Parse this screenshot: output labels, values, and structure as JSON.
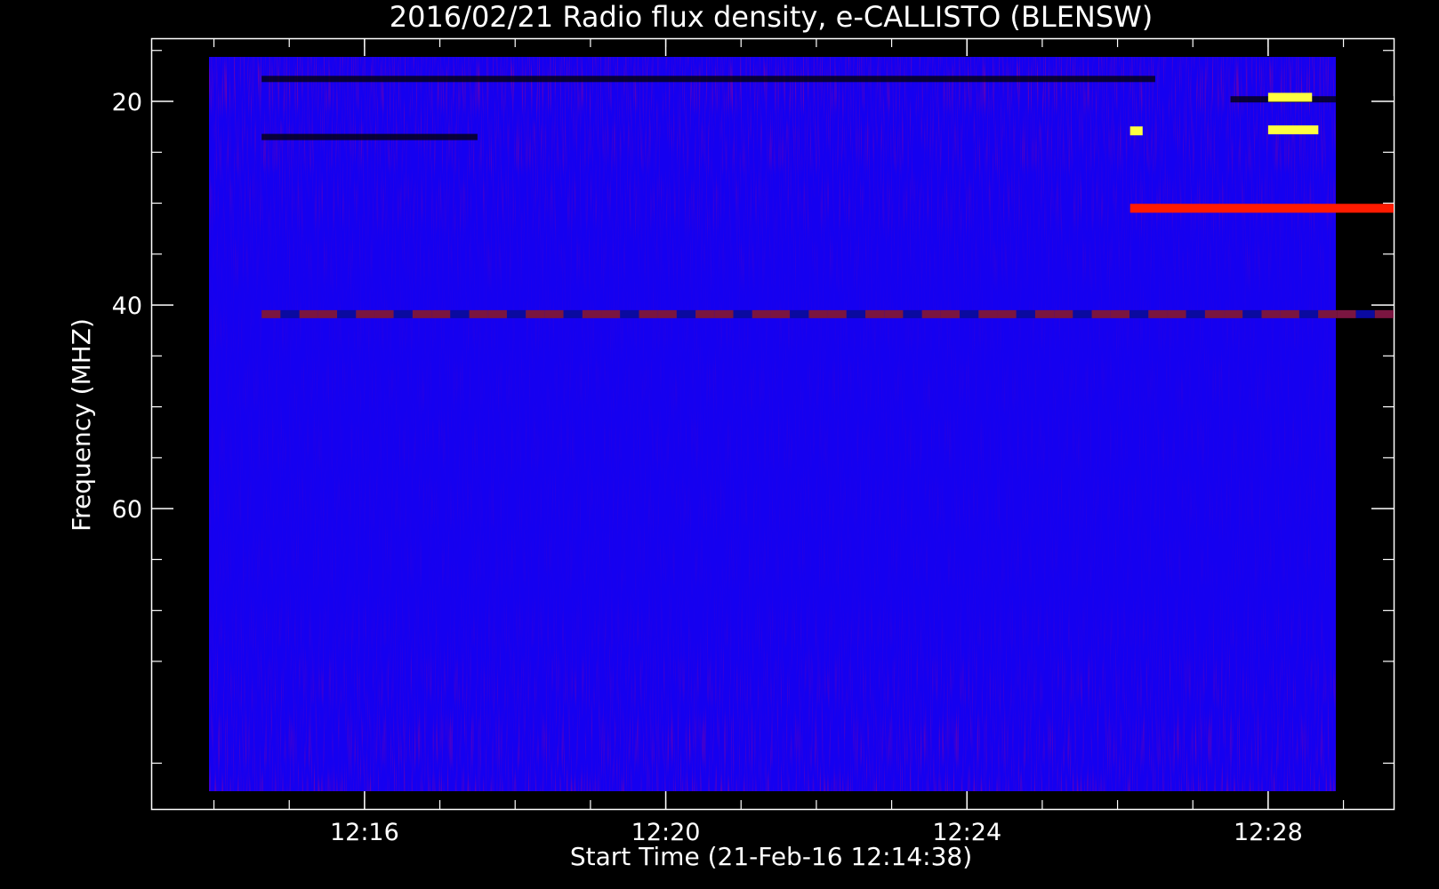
{
  "chart_data": {
    "type": "heatmap",
    "title": "2016/02/21  Radio flux density, e-CALLISTO (BLENSW)",
    "xlabel": "Start Time (21-Feb-16 12:14:38)",
    "ylabel": "Frequency (MHZ)",
    "x_ticks": [
      "12:16",
      "12:20",
      "12:24",
      "12:28"
    ],
    "y_ticks": [
      "20",
      "40",
      "60"
    ],
    "xlim": [
      "12:13:10",
      "12:29:40"
    ],
    "ylim": [
      89.5,
      13.8
    ],
    "data_extent": {
      "x": [
        "12:14:38",
        "12:29:40"
      ],
      "y": [
        15.6,
        87.6
      ]
    },
    "colormap": [
      "#000000",
      "#1500f0",
      "#ff1a00",
      "#ffff40"
    ],
    "background_color": "#1500f0",
    "features": [
      {
        "kind": "dark band",
        "freq_mhz": 17.8,
        "t_start": "12:14:38",
        "t_end": "12:26:30"
      },
      {
        "kind": "dark band",
        "freq_mhz": 19.8,
        "t_start": "12:27:30",
        "t_end": "12:29:40"
      },
      {
        "kind": "dark band",
        "freq_mhz": 23.5,
        "t_start": "12:14:38",
        "t_end": "12:17:30"
      },
      {
        "kind": "red interference line",
        "freq_mhz": 30.5,
        "t_start": "12:26:10",
        "t_end": "12:29:40"
      },
      {
        "kind": "dashed line",
        "freq_mhz": 40.9,
        "t_start": "12:14:38",
        "t_end": "12:29:40"
      },
      {
        "kind": "bright burst",
        "freq_mhz": 22.8,
        "t_start": "12:28:00",
        "t_end": "12:28:40"
      },
      {
        "kind": "bright burst",
        "freq_mhz": 19.6,
        "t_start": "12:28:00",
        "t_end": "12:28:35"
      },
      {
        "kind": "bright burst",
        "freq_mhz": 22.9,
        "t_start": "12:26:10",
        "t_end": "12:26:20"
      }
    ]
  }
}
